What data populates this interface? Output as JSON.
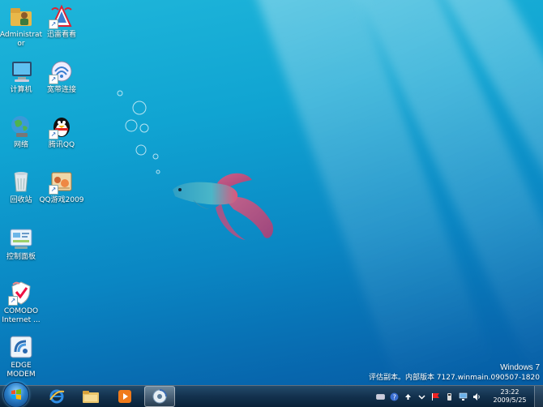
{
  "desktop_icons": [
    {
      "label": "Administrator"
    },
    {
      "label": "迅雷看看"
    },
    {
      "label": "计算机"
    },
    {
      "label": "宽带连接"
    },
    {
      "label": "网络"
    },
    {
      "label": "腾讯QQ"
    },
    {
      "label": "回收站"
    },
    {
      "label": "QQ游戏2009"
    },
    {
      "label": "控制面板"
    },
    {
      "label": "COMODO Internet ..."
    },
    {
      "label": "EDGE MODEM"
    }
  ],
  "watermark": {
    "title": "Windows 7",
    "build": "评估副本。内部版本 7127.winmain.090507-1820"
  },
  "taskbar": {
    "pinned": [
      "internet-explorer",
      "windows-explorer",
      "media-player",
      "active-app"
    ]
  },
  "tray": {
    "time": "23:22",
    "date": "2009/5/25"
  }
}
